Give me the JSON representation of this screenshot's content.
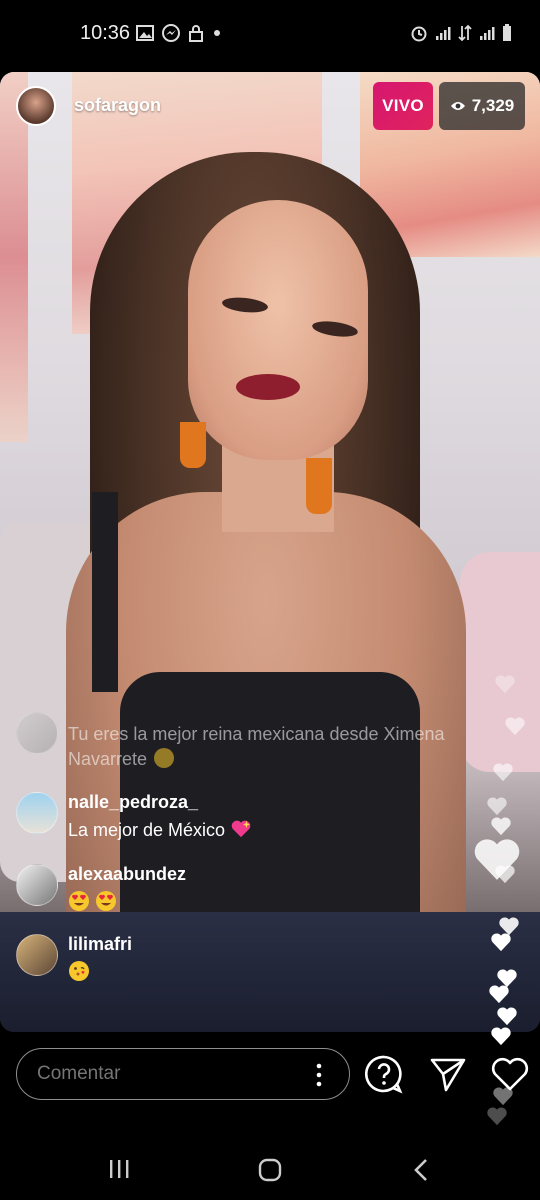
{
  "status_bar": {
    "time": "10:36",
    "left_icons": [
      "gallery-icon",
      "messenger-icon",
      "lock-icon",
      "dot-icon"
    ],
    "right_icons": [
      "alarm-icon",
      "signal-icon",
      "data-icon",
      "signal-icon",
      "battery-icon"
    ]
  },
  "live": {
    "username": "sofaragon",
    "live_label": "VIVO",
    "viewer_count": "7,329",
    "accent": "#e0245e"
  },
  "comments": [
    {
      "user": "",
      "text": "Tu eres la mejor reina mexicana desde Ximena Navarrete",
      "emoji": "smiling-face-with-hearts",
      "faded": true
    },
    {
      "user": "nalle_pedroza_",
      "text": "La mejor de México",
      "emoji": "sparkling-heart"
    },
    {
      "user": "alexaabundez",
      "text": "",
      "emoji": "heart-eyes x2"
    },
    {
      "user": "lilimafri",
      "text": "",
      "emoji": "face-blowing-kiss"
    }
  ],
  "bottom_bar": {
    "comment_placeholder": "Comentar",
    "icons": [
      "more-icon",
      "question-icon",
      "send-icon",
      "heart-icon"
    ]
  },
  "nav_bar": {
    "icons": [
      "recents-icon",
      "home-icon",
      "back-icon"
    ]
  }
}
